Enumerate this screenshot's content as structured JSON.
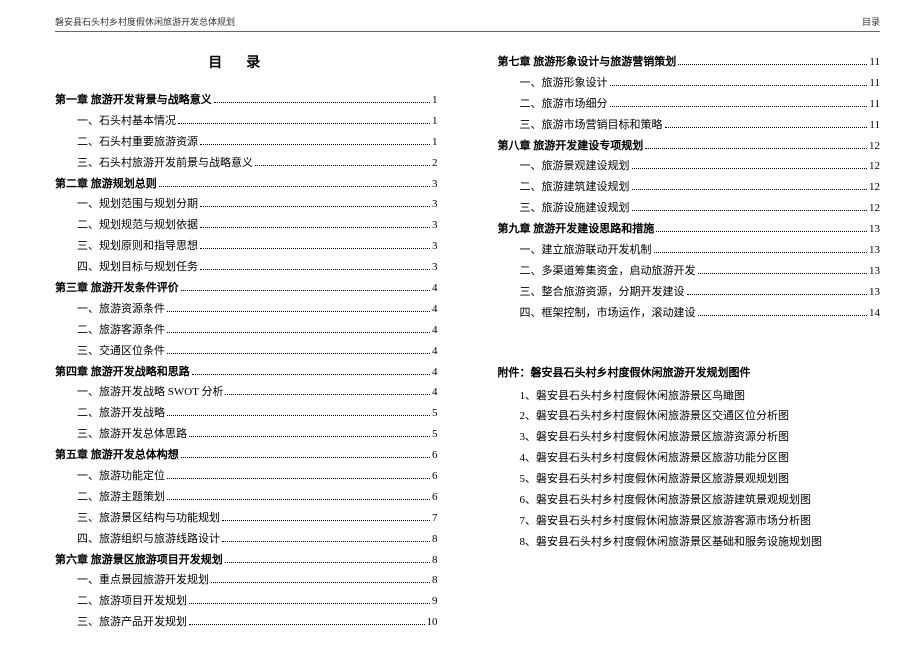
{
  "header": {
    "left": "磐安县石头村乡村度假休闲旅游开发总体规划",
    "right": "目录"
  },
  "toc_title": "目录",
  "left_col": [
    {
      "type": "chapter",
      "label": "第一章  旅游开发背景与战略意义",
      "page": "1"
    },
    {
      "type": "sub",
      "label": "一、石头村基本情况",
      "page": "1"
    },
    {
      "type": "sub",
      "label": "二、石头村重要旅游资源",
      "page": "1"
    },
    {
      "type": "sub",
      "label": "三、石头村旅游开发前景与战略意义",
      "page": "2"
    },
    {
      "type": "chapter",
      "label": "第二章  旅游规划总则",
      "page": "3"
    },
    {
      "type": "sub",
      "label": "一、规划范围与规划分期",
      "page": "3"
    },
    {
      "type": "sub",
      "label": "二、规划规范与规划依据",
      "page": "3"
    },
    {
      "type": "sub",
      "label": "三、规划原则和指导思想",
      "page": "3"
    },
    {
      "type": "sub",
      "label": "四、规划目标与规划任务",
      "page": "3"
    },
    {
      "type": "chapter",
      "label": "第三章  旅游开发条件评价",
      "page": "4"
    },
    {
      "type": "sub",
      "label": "一、旅游资源条件",
      "page": "4"
    },
    {
      "type": "sub",
      "label": "二、旅游客源条件",
      "page": "4"
    },
    {
      "type": "sub",
      "label": "三、交通区位条件",
      "page": "4"
    },
    {
      "type": "chapter",
      "label": "第四章  旅游开发战略和思路",
      "page": "4"
    },
    {
      "type": "sub",
      "label": "一、旅游开发战略 SWOT 分析",
      "page": "4"
    },
    {
      "type": "sub",
      "label": "二、旅游开发战略",
      "page": "5"
    },
    {
      "type": "sub",
      "label": "三、旅游开发总体思路",
      "page": "5"
    },
    {
      "type": "chapter",
      "label": "第五章  旅游开发总体构想",
      "page": "6"
    },
    {
      "type": "sub",
      "label": "一、旅游功能定位",
      "page": "6"
    },
    {
      "type": "sub",
      "label": "二、旅游主题策划",
      "page": "6"
    },
    {
      "type": "sub",
      "label": "三、旅游景区结构与功能规划",
      "page": "7"
    },
    {
      "type": "sub",
      "label": "四、旅游组织与旅游线路设计",
      "page": "8"
    },
    {
      "type": "chapter",
      "label": "第六章  旅游景区旅游项目开发规划",
      "page": "8"
    },
    {
      "type": "sub",
      "label": "一、重点景园旅游开发规划",
      "page": "8"
    },
    {
      "type": "sub",
      "label": "二、旅游项目开发规划",
      "page": "9"
    },
    {
      "type": "sub",
      "label": "三、旅游产品开发规划",
      "page": "10"
    }
  ],
  "right_col": [
    {
      "type": "chapter",
      "label": "第七章  旅游形象设计与旅游营销策划",
      "page": "11"
    },
    {
      "type": "sub",
      "label": "一、旅游形象设计",
      "page": "11"
    },
    {
      "type": "sub",
      "label": "二、旅游市场细分",
      "page": "11"
    },
    {
      "type": "sub",
      "label": "三、旅游市场营销目标和策略",
      "page": "11"
    },
    {
      "type": "chapter",
      "label": "第八章  旅游开发建设专项规划",
      "page": "12"
    },
    {
      "type": "sub",
      "label": "一、旅游景观建设规划",
      "page": "12"
    },
    {
      "type": "sub",
      "label": "二、旅游建筑建设规划",
      "page": "12"
    },
    {
      "type": "sub",
      "label": "三、旅游设施建设规划",
      "page": "12"
    },
    {
      "type": "chapter",
      "label": "第九章  旅游开发建设思路和措施",
      "page": "13"
    },
    {
      "type": "sub",
      "label": "一、建立旅游联动开发机制",
      "page": "13"
    },
    {
      "type": "sub",
      "label": "二、多渠道筹集资金，启动旅游开发",
      "page": "13"
    },
    {
      "type": "sub",
      "label": "三、整合旅游资源，分期开发建设",
      "page": "13"
    },
    {
      "type": "sub",
      "label": "四、框架控制，市场运作，滚动建设",
      "page": "14"
    }
  ],
  "appendix": {
    "title": "附件：磐安县石头村乡村度假休闲旅游开发规划图件",
    "items": [
      "1、磐安县石头村乡村度假休闲旅游景区鸟瞰图",
      "2、磐安县石头村乡村度假休闲旅游景区交通区位分析图",
      "3、磐安县石头村乡村度假休闲旅游景区旅游资源分析图",
      "4、磐安县石头村乡村度假休闲旅游景区旅游功能分区图",
      "5、磐安县石头村乡村度假休闲旅游景区旅游景观规划图",
      "6、磐安县石头村乡村度假休闲旅游景区旅游建筑景观规划图",
      "7、磐安县石头村乡村度假休闲旅游景区旅游客源市场分析图",
      "8、磐安县石头村乡村度假休闲旅游景区基础和服务设施规划图"
    ]
  }
}
